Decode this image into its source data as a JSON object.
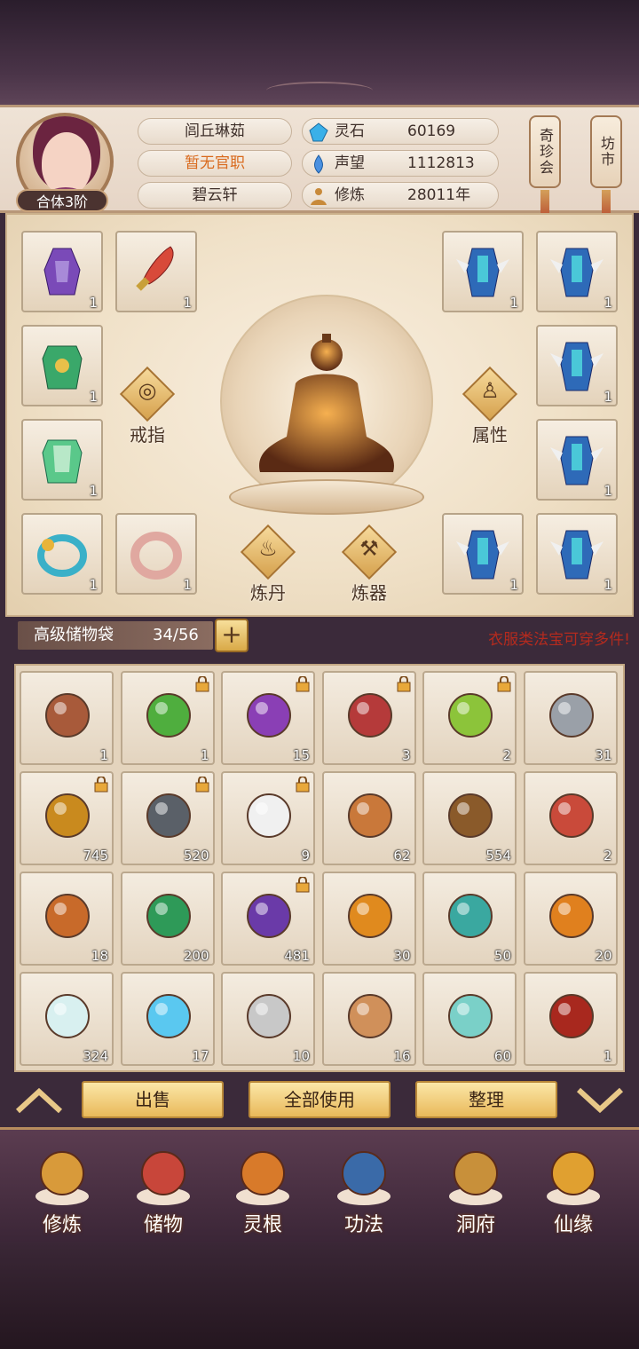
{
  "profile": {
    "rank": "合体3阶",
    "name": "闾丘琳茹",
    "official": "暂无官职",
    "sect": "碧云轩"
  },
  "stats": [
    {
      "label": "灵石",
      "value": "60169",
      "icon": "spirit-stone-icon"
    },
    {
      "label": "声望",
      "value": "1112813",
      "icon": "reputation-icon"
    },
    {
      "label": "修炼",
      "value": "28011年",
      "icon": "cultivation-icon"
    }
  ],
  "shops": {
    "treasure": "奇珍会",
    "market": "坊市"
  },
  "equipment": {
    "left_slots": [
      {
        "name": "purple-robe",
        "count": "1"
      },
      {
        "name": "red-sword",
        "count": "1"
      },
      {
        "name": "green-armor",
        "count": "1"
      },
      {
        "name": "jade-armor",
        "count": "1"
      },
      {
        "name": "gold-ring",
        "count": "1"
      },
      {
        "name": "silver-ring",
        "count": "1"
      }
    ],
    "right_slots": [
      {
        "name": "winged-robe",
        "count": "1"
      },
      {
        "name": "winged-robe",
        "count": "1"
      },
      {
        "name": "winged-robe",
        "count": "1"
      },
      {
        "name": "winged-robe",
        "count": "1"
      },
      {
        "name": "winged-robe",
        "count": "1"
      },
      {
        "name": "winged-robe",
        "count": "1"
      }
    ],
    "buttons": {
      "ring": "戒指",
      "attr": "属性",
      "alchemy": "炼丹",
      "forge": "炼器"
    }
  },
  "storage": {
    "title": "高级储物袋",
    "count": "34/56",
    "plus": "+",
    "notice": "衣服类法宝可穿多件!"
  },
  "inventory": [
    {
      "count": "1",
      "locked": false,
      "item": "brown-ring",
      "color": "#a85a3a"
    },
    {
      "count": "1",
      "locked": true,
      "item": "green-orb",
      "color": "#4fae3e"
    },
    {
      "count": "15",
      "locked": true,
      "item": "purple-orb",
      "color": "#8a3fb5"
    },
    {
      "count": "3",
      "locked": true,
      "item": "red-orb",
      "color": "#b53a3a"
    },
    {
      "count": "2",
      "locked": true,
      "item": "lime-orb",
      "color": "#8cc43a"
    },
    {
      "count": "31",
      "locked": false,
      "item": "silver-crystal",
      "color": "#9aa0a8"
    },
    {
      "count": "745",
      "locked": true,
      "item": "gold-ore",
      "color": "#c98a1e"
    },
    {
      "count": "520",
      "locked": true,
      "item": "iron-ore",
      "color": "#5a6068"
    },
    {
      "count": "9",
      "locked": true,
      "item": "white-flower",
      "color": "#f0f0f0"
    },
    {
      "count": "62",
      "locked": false,
      "item": "ginseng",
      "color": "#c9783a"
    },
    {
      "count": "554",
      "locked": false,
      "item": "root-herb",
      "color": "#8a5a2a"
    },
    {
      "count": "2",
      "locked": false,
      "item": "red-flower-herb",
      "color": "#c94a3a"
    },
    {
      "count": "18",
      "locked": false,
      "item": "dragon-root",
      "color": "#c86a2a"
    },
    {
      "count": "200",
      "locked": false,
      "item": "emerald-crystal",
      "color": "#2e9a58"
    },
    {
      "count": "481",
      "locked": true,
      "item": "purple-berries",
      "color": "#6a3aa8"
    },
    {
      "count": "30",
      "locked": false,
      "item": "lotus-pod",
      "color": "#e08a1e"
    },
    {
      "count": "50",
      "locked": false,
      "item": "jade-gourd",
      "color": "#3aa8a0"
    },
    {
      "count": "20",
      "locked": false,
      "item": "orange-gourd",
      "color": "#e0801e"
    },
    {
      "count": "324",
      "locked": false,
      "item": "white-vase",
      "color": "#d8f0f0"
    },
    {
      "count": "17",
      "locked": false,
      "item": "glowing-bowl",
      "color": "#5ac8f0"
    },
    {
      "count": "10",
      "locked": false,
      "item": "silver-orb",
      "color": "#c8c8c8"
    },
    {
      "count": "16",
      "locked": false,
      "item": "gem-ring",
      "color": "#d0905a"
    },
    {
      "count": "60",
      "locked": false,
      "item": "jade-bottle",
      "color": "#7ad0c8"
    },
    {
      "count": "1",
      "locked": false,
      "item": "red-teapot",
      "color": "#a8281e"
    }
  ],
  "actions": {
    "sell": "出售",
    "use_all": "全部使用",
    "sort": "整理"
  },
  "nav": [
    {
      "label": "修炼",
      "icon": "cultivation-nav-icon",
      "color": "#d89a3a"
    },
    {
      "label": "储物",
      "icon": "bag-nav-icon",
      "color": "#c8463a"
    },
    {
      "label": "灵根",
      "icon": "spirit-root-nav-icon",
      "color": "#d87a2a"
    },
    {
      "label": "功法",
      "icon": "book-nav-icon",
      "color": "#3a6aa8"
    },
    {
      "label": "洞府",
      "icon": "cave-nav-icon",
      "color": "#c8903a"
    },
    {
      "label": "仙缘",
      "icon": "fate-nav-icon",
      "color": "#e0a030"
    }
  ]
}
